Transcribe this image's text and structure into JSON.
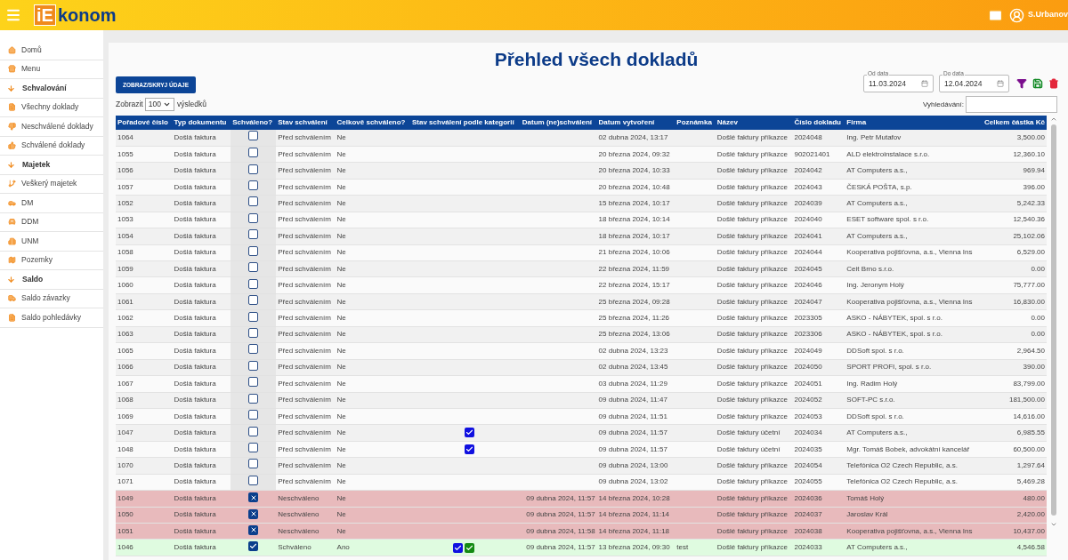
{
  "header": {
    "logo_mark": "iE",
    "logo_text": "konom",
    "user": "S.Urbanov"
  },
  "sidebar": {
    "items": [
      {
        "kind": "link",
        "label": "Domů"
      },
      {
        "kind": "link",
        "label": "Menu"
      },
      {
        "kind": "section",
        "label": "Schvalování"
      },
      {
        "kind": "link",
        "label": "Všechny doklady"
      },
      {
        "kind": "link",
        "label": "Neschválené doklady"
      },
      {
        "kind": "link",
        "label": "Schválené doklady"
      },
      {
        "kind": "section",
        "label": "Majetek"
      },
      {
        "kind": "link",
        "label": "Veškerý majetek"
      },
      {
        "kind": "link",
        "label": "DM"
      },
      {
        "kind": "link",
        "label": "DDM"
      },
      {
        "kind": "link",
        "label": "UNM"
      },
      {
        "kind": "link",
        "label": "Pozemky"
      },
      {
        "kind": "section",
        "label": "Saldo"
      },
      {
        "kind": "link",
        "label": "Saldo závazky"
      },
      {
        "kind": "link",
        "label": "Saldo pohledávky"
      }
    ]
  },
  "page": {
    "title": "Přehled všech dokladů",
    "toggle_button": "ZOBRAZ/SKRYJ ÚDAJE",
    "show_label": "Zobrazit",
    "page_size": "100",
    "show_suffix": "výsledků",
    "date_from": {
      "label": "Od data",
      "value": "11.03.2024"
    },
    "date_to": {
      "label": "Do data",
      "value": "12.04.2024"
    },
    "search_label": "Vyhledávání:"
  },
  "table": {
    "columns": [
      "Pořadové číslo",
      "Typ dokumentu",
      "Schváleno?",
      "Stav schválení",
      "Celkově schváleno?",
      "Stav schválení podle kategorií",
      "Datum (ne)schválení",
      "Datum vytvoření",
      "Poznámka",
      "Název",
      "Číslo dokladu",
      "Firma",
      "Celkem částka Kč"
    ],
    "rows": [
      {
        "id": "1064",
        "type": "Došlá faktura",
        "checked": false,
        "rejected": false,
        "status": "Před schválením",
        "overall": "Ne",
        "created": "02 dubna 2024, 13:17",
        "name": "Došlé faktury příkazce",
        "number": "2024048",
        "company": "Ing. Petr Mutafov",
        "amount": "3,500.00"
      },
      {
        "id": "1055",
        "type": "Došlá faktura",
        "checked": false,
        "rejected": false,
        "status": "Před schválením",
        "overall": "Ne",
        "created": "20 března 2024, 09:32",
        "name": "Došlé faktury příkazce",
        "number": "902021401",
        "company": "ALD elektroinstalace s.r.o.",
        "amount": "12,360.10"
      },
      {
        "id": "1056",
        "type": "Došlá faktura",
        "checked": false,
        "rejected": false,
        "status": "Před schválením",
        "overall": "Ne",
        "created": "20 března 2024, 10:33",
        "name": "Došlé faktury příkazce",
        "number": "2024042",
        "company": "AT Computers a.s.,",
        "amount": "969.94"
      },
      {
        "id": "1057",
        "type": "Došlá faktura",
        "checked": false,
        "rejected": false,
        "status": "Před schválením",
        "overall": "Ne",
        "created": "20 března 2024, 10:48",
        "name": "Došlé faktury příkazce",
        "number": "2024043",
        "company": "ČESKÁ POŠTA, s.p.",
        "amount": "396.00"
      },
      {
        "id": "1052",
        "type": "Došlá faktura",
        "checked": false,
        "rejected": false,
        "status": "Před schválením",
        "overall": "Ne",
        "created": "15 března 2024, 10:17",
        "name": "Došlé faktury příkazce",
        "number": "2024039",
        "company": "AT Computers a.s.,",
        "amount": "5,242.33"
      },
      {
        "id": "1053",
        "type": "Došlá faktura",
        "checked": false,
        "rejected": false,
        "status": "Před schválením",
        "overall": "Ne",
        "created": "18 března 2024, 10:14",
        "name": "Došlé faktury příkazce",
        "number": "2024040",
        "company": "ESET software spol. s r.o.",
        "amount": "12,540.36"
      },
      {
        "id": "1054",
        "type": "Došlá faktura",
        "checked": false,
        "rejected": false,
        "status": "Před schválením",
        "overall": "Ne",
        "created": "18 března 2024, 10:17",
        "name": "Došlé faktury příkazce",
        "number": "2024041",
        "company": "AT Computers a.s.,",
        "amount": "25,102.06"
      },
      {
        "id": "1058",
        "type": "Došlá faktura",
        "checked": false,
        "rejected": false,
        "status": "Před schválením",
        "overall": "Ne",
        "created": "21 března 2024, 10:06",
        "name": "Došlé faktury příkazce",
        "number": "2024044",
        "company": "Kooperativa pojišťovna, a.s., Vienna Ins",
        "amount": "6,529.00"
      },
      {
        "id": "1059",
        "type": "Došlá faktura",
        "checked": false,
        "rejected": false,
        "status": "Před schválením",
        "overall": "Ne",
        "created": "22 března 2024, 11:59",
        "name": "Došlé faktury příkazce",
        "number": "2024045",
        "company": "Ceit Brno s.r.o.",
        "amount": "0.00"
      },
      {
        "id": "1060",
        "type": "Došlá faktura",
        "checked": false,
        "rejected": false,
        "status": "Před schválením",
        "overall": "Ne",
        "created": "22 března 2024, 15:17",
        "name": "Došlé faktury příkazce",
        "number": "2024046",
        "company": "Ing. Jeronym Holý",
        "amount": "75,777.00"
      },
      {
        "id": "1061",
        "type": "Došlá faktura",
        "checked": false,
        "rejected": false,
        "status": "Před schválením",
        "overall": "Ne",
        "created": "25 března 2024, 09:28",
        "name": "Došlé faktury příkazce",
        "number": "2024047",
        "company": "Kooperativa pojišťovna, a.s., Vienna Ins",
        "amount": "16,830.00"
      },
      {
        "id": "1062",
        "type": "Došlá faktura",
        "checked": false,
        "rejected": false,
        "status": "Před schválením",
        "overall": "Ne",
        "created": "25 března 2024, 11:26",
        "name": "Došlé faktury příkazce",
        "number": "2023305",
        "company": "ASKO - NÁBYTEK, spol. s r.o.",
        "amount": "0.00"
      },
      {
        "id": "1063",
        "type": "Došlá faktura",
        "checked": false,
        "rejected": false,
        "status": "Před schválením",
        "overall": "Ne",
        "created": "25 března 2024, 13:06",
        "name": "Došlé faktury příkazce",
        "number": "2023306",
        "company": "ASKO - NÁBYTEK, spol. s r.o.",
        "amount": "0.00"
      },
      {
        "id": "1065",
        "type": "Došlá faktura",
        "checked": false,
        "rejected": false,
        "status": "Před schválením",
        "overall": "Ne",
        "created": "02 dubna 2024, 13:23",
        "name": "Došlé faktury příkazce",
        "number": "2024049",
        "company": "DDSoft spol. s r.o.",
        "amount": "2,964.50"
      },
      {
        "id": "1066",
        "type": "Došlá faktura",
        "checked": false,
        "rejected": false,
        "status": "Před schválením",
        "overall": "Ne",
        "created": "02 dubna 2024, 13:45",
        "name": "Došlé faktury příkazce",
        "number": "2024050",
        "company": "SPORT PROFI, spol. s r.o.",
        "amount": "390.00"
      },
      {
        "id": "1067",
        "type": "Došlá faktura",
        "checked": false,
        "rejected": false,
        "status": "Před schválením",
        "overall": "Ne",
        "created": "03 dubna 2024, 11:29",
        "name": "Došlé faktury příkazce",
        "number": "2024051",
        "company": "Ing. Radim Holý",
        "amount": "83,799.00"
      },
      {
        "id": "1068",
        "type": "Došlá faktura",
        "checked": false,
        "rejected": false,
        "status": "Před schválením",
        "overall": "Ne",
        "created": "09 dubna 2024, 11:47",
        "name": "Došlé faktury příkazce",
        "number": "2024052",
        "company": "SOFT-PC s.r.o.",
        "amount": "181,500.00"
      },
      {
        "id": "1069",
        "type": "Došlá faktura",
        "checked": false,
        "rejected": false,
        "status": "Před schválením",
        "overall": "Ne",
        "created": "09 dubna 2024, 11:51",
        "name": "Došlé faktury příkazce",
        "number": "2024053",
        "company": "DDSoft spol. s r.o.",
        "amount": "14,616.00"
      },
      {
        "id": "1047",
        "type": "Došlá faktura",
        "checked": false,
        "rejected": false,
        "status": "Před schválením",
        "overall": "Ne",
        "categories": [
          {
            "color": "#1010e0"
          }
        ],
        "created": "09 dubna 2024, 11:57",
        "name": "Došlé faktury účetní",
        "number": "2024034",
        "company": "AT Computers a.s.,",
        "amount": "6,985.55"
      },
      {
        "id": "1048",
        "type": "Došlá faktura",
        "checked": false,
        "rejected": false,
        "status": "Před schválením",
        "overall": "Ne",
        "categories": [
          {
            "color": "#1010e0"
          }
        ],
        "created": "09 dubna 2024, 11:57",
        "name": "Došlé faktury účetní",
        "number": "2024035",
        "company": "Mgr. Tomáš Bobek, advokátní kancelář",
        "amount": "60,500.00"
      },
      {
        "id": "1070",
        "type": "Došlá faktura",
        "checked": false,
        "rejected": false,
        "status": "Před schválením",
        "overall": "Ne",
        "created": "09 dubna 2024, 13:00",
        "name": "Došlé faktury příkazce",
        "number": "2024054",
        "company": "Telefónica O2 Czech Republic, a.s.",
        "amount": "1,297.64"
      },
      {
        "id": "1071",
        "type": "Došlá faktura",
        "checked": false,
        "rejected": false,
        "status": "Před schválením",
        "overall": "Ne",
        "created": "09 dubna 2024, 13:02",
        "name": "Došlé faktury příkazce",
        "number": "2024055",
        "company": "Telefónica O2 Czech Republic, a.s.",
        "amount": "5,469.28"
      },
      {
        "id": "1049",
        "type": "Došlá faktura",
        "rejected": true,
        "status": "Neschváleno",
        "overall": "Ne",
        "decided": "09 dubna 2024, 11:57",
        "created": "14 března 2024, 10:28",
        "name": "Došlé faktury příkazce",
        "number": "2024036",
        "company": "Tomáš Holý",
        "amount": "480.00"
      },
      {
        "id": "1050",
        "type": "Došlá faktura",
        "rejected": true,
        "status": "Neschváleno",
        "overall": "Ne",
        "decided": "09 dubna 2024, 11:57",
        "created": "14 března 2024, 11:14",
        "name": "Došlé faktury příkazce",
        "number": "2024037",
        "company": "Jaroslav Král",
        "amount": "2,420.00"
      },
      {
        "id": "1051",
        "type": "Došlá faktura",
        "rejected": true,
        "status": "Neschváleno",
        "overall": "Ne",
        "decided": "09 dubna 2024, 11:58",
        "created": "14 března 2024, 11:18",
        "name": "Došlé faktury příkazce",
        "number": "2024038",
        "company": "Kooperativa pojišťovna, a.s., Vienna Ins",
        "amount": "10,437.00"
      },
      {
        "id": "1046",
        "type": "Došlá faktura",
        "checked": true,
        "status": "Schváleno",
        "overall": "Ano",
        "categories": [
          {
            "color": "#1010e0"
          },
          {
            "color": "#138a13"
          }
        ],
        "decided": "09 dubna 2024, 11:57",
        "created": "13 března 2024, 09:30",
        "note": "test",
        "name": "Došlé faktury příkazce",
        "number": "2024033",
        "company": "AT Computers a.s.,",
        "amount": "4,546.58"
      }
    ]
  }
}
